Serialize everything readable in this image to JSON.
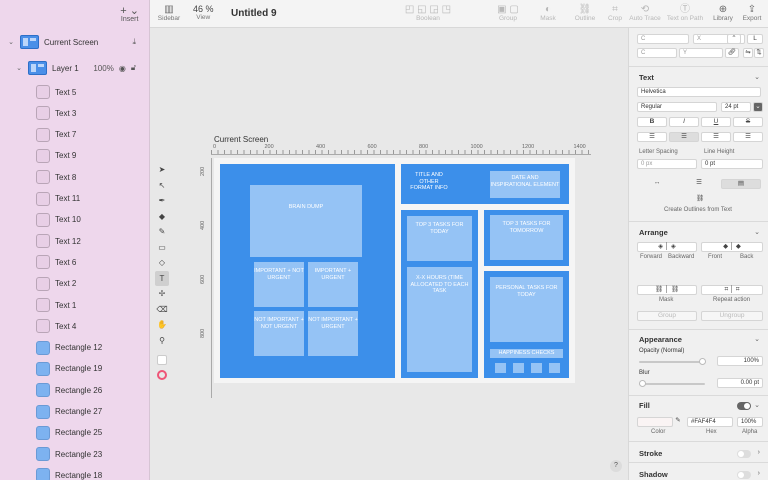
{
  "toolbar": {
    "insert": "Insert",
    "sidebar": "Sidebar",
    "zoom": "46 %",
    "view": "View",
    "doc_title": "Untitled 9",
    "boolean": "Boolean",
    "group": "Group",
    "mask": "Mask",
    "outline": "Outline",
    "crop": "Crop",
    "auto_trace": "Auto Trace",
    "text_on_path": "Text on Path",
    "library": "Library",
    "export": "Export"
  },
  "sidebar": {
    "artboard": "Current Screen",
    "layer": "Layer 1",
    "layer_opacity": "100%",
    "items": [
      {
        "name": "Text 5",
        "kind": "text"
      },
      {
        "name": "Text 3",
        "kind": "text"
      },
      {
        "name": "Text 7",
        "kind": "text"
      },
      {
        "name": "Text 9",
        "kind": "text"
      },
      {
        "name": "Text 8",
        "kind": "text"
      },
      {
        "name": "Text 11",
        "kind": "text"
      },
      {
        "name": "Text 10",
        "kind": "text"
      },
      {
        "name": "Text 12",
        "kind": "text"
      },
      {
        "name": "Text 6",
        "kind": "text"
      },
      {
        "name": "Text 2",
        "kind": "text"
      },
      {
        "name": "Text 1",
        "kind": "text"
      },
      {
        "name": "Text 4",
        "kind": "text"
      },
      {
        "name": "Rectangle 12",
        "kind": "rect"
      },
      {
        "name": "Rectangle 19",
        "kind": "rect"
      },
      {
        "name": "Rectangle 26",
        "kind": "rect"
      },
      {
        "name": "Rectangle 27",
        "kind": "rect"
      },
      {
        "name": "Rectangle 25",
        "kind": "rect"
      },
      {
        "name": "Rectangle 23",
        "kind": "rect"
      },
      {
        "name": "Rectangle 18",
        "kind": "rect"
      }
    ]
  },
  "canvas": {
    "artboard_label": "Current Screen",
    "ruler_h": [
      "0",
      "200",
      "400",
      "600",
      "800",
      "1000",
      "1200",
      "1400"
    ],
    "ruler_v": [
      "200",
      "400",
      "600",
      "800"
    ],
    "brain_dump": "BRAIN DUMP",
    "important_not_urgent": "IMPORTANT + NOT URGENT",
    "important_urgent": "IMPORTANT + URGENT",
    "not_important_not_urgent": "NOT IMPORTANT + NOT URGENT",
    "not_important_urgent": "NOT IMPORTANT + URGENT",
    "title_info": "TITLE AND OTHER FORMAT INFO",
    "date_element": "DATE AND INSPIRATIONAL ELEMENT",
    "top3_today": "TOP 3 TASKS FOR TODAY",
    "top3_tomorrow": "TOP 3 TASKS FOR TOMORROW",
    "hours": "X-X HOURS (TIME ALLOCATED TO EACH TASK",
    "personal": "PERSONAL TASKS FOR TODAY",
    "habits": "HAPPINESS CHECKS"
  },
  "inspector": {
    "text_title": "Text",
    "font": "Helvetica",
    "weight": "Regular",
    "size": "24 pt",
    "letter_spacing_label": "Letter Spacing",
    "letter_spacing": "0 px",
    "line_height_label": "Line Height",
    "line_height": "0 pt",
    "outlines": "Create Outlines from Text",
    "arrange_title": "Arrange",
    "forward": "Forward",
    "backward": "Backward",
    "front": "Front",
    "back": "Back",
    "mask": "Mask",
    "repeat_action": "Repeat action",
    "group": "Group",
    "ungroup": "Ungroup",
    "appearance_title": "Appearance",
    "opacity_label": "Opacity (Normal)",
    "opacity": "100%",
    "blur_label": "Blur",
    "blur": "0.00 pt",
    "fill_title": "Fill",
    "fill_hex": "#FAF4F4",
    "fill_alpha": "100%",
    "color_label": "Color",
    "hex_label": "Hex",
    "alpha_label": "Alpha",
    "stroke_title": "Stroke",
    "shadow_title": "Shadow"
  }
}
